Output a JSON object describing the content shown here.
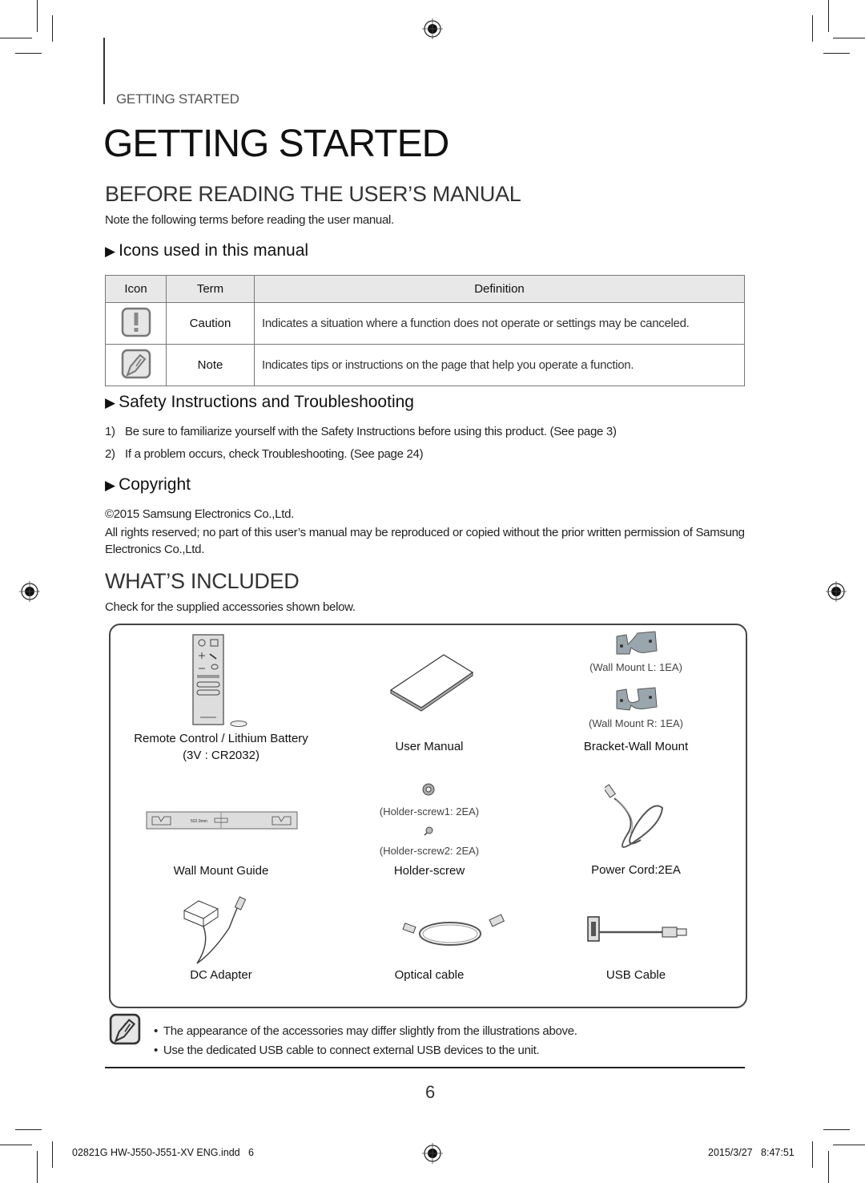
{
  "header": {
    "section_label": "GETTING STARTED",
    "page_title": "GETTING STARTED"
  },
  "before_reading": {
    "heading": "BEFORE READING THE USER’S MANUAL",
    "intro": "Note the following terms before reading the user manual.",
    "icons_subheading": "Icons used in this manual",
    "table": {
      "headers": [
        "Icon",
        "Term",
        "Definition"
      ],
      "rows": [
        {
          "icon": "caution-icon",
          "term": "Caution",
          "definition": "Indicates a situation where a function does not operate or settings may be canceled."
        },
        {
          "icon": "note-icon",
          "term": "Note",
          "definition": "Indicates tips or instructions on the page that help you operate a function."
        }
      ]
    },
    "safety_subheading": "Safety Instructions and Troubleshooting",
    "safety_items": [
      {
        "num": "1)",
        "text": "Be sure to familiarize yourself with the Safety Instructions before using this product. (See page 3)"
      },
      {
        "num": "2)",
        "text": "If a problem occurs, check Troubleshooting. (See page 24)"
      }
    ],
    "copyright_subheading": "Copyright",
    "copyright_line": "©2015 Samsung Electronics Co.,Ltd.",
    "copyright_text": "All rights reserved; no part of this user’s manual may be reproduced or copied without the prior written permission of Samsung Electronics Co.,Ltd."
  },
  "whats_included": {
    "heading": "WHAT’S INCLUDED",
    "intro": "Check for the supplied accessories shown below.",
    "items": {
      "remote": {
        "label_1": "Remote Control / Lithium Battery",
        "label_2": "(3V : CR2032)"
      },
      "manual": {
        "label": "User Manual"
      },
      "bracket": {
        "label": "Bracket-Wall Mount",
        "sub_l": "(Wall Mount L: 1EA)",
        "sub_r": "(Wall Mount R: 1EA)"
      },
      "guide": {
        "label": "Wall Mount Guide",
        "dimension": "502.0mm"
      },
      "screw": {
        "label": "Holder-screw",
        "sub_1": "(Holder-screw1: 2EA)",
        "sub_2": "(Holder-screw2: 2EA)"
      },
      "power_cord": {
        "label": "Power Cord:2EA"
      },
      "dc_adapter": {
        "label": "DC Adapter"
      },
      "optical": {
        "label": "Optical cable"
      },
      "usb": {
        "label": "USB Cable"
      }
    },
    "notes": [
      "The appearance of the accessories may differ slightly from the illustrations above.",
      "Use the dedicated USB cable to connect external USB devices to the unit."
    ]
  },
  "page_number": "6",
  "footer": {
    "file": "02821G HW-J550-J551-XV ENG.indd   6",
    "timestamp": "2015/3/27   8:47:51"
  }
}
